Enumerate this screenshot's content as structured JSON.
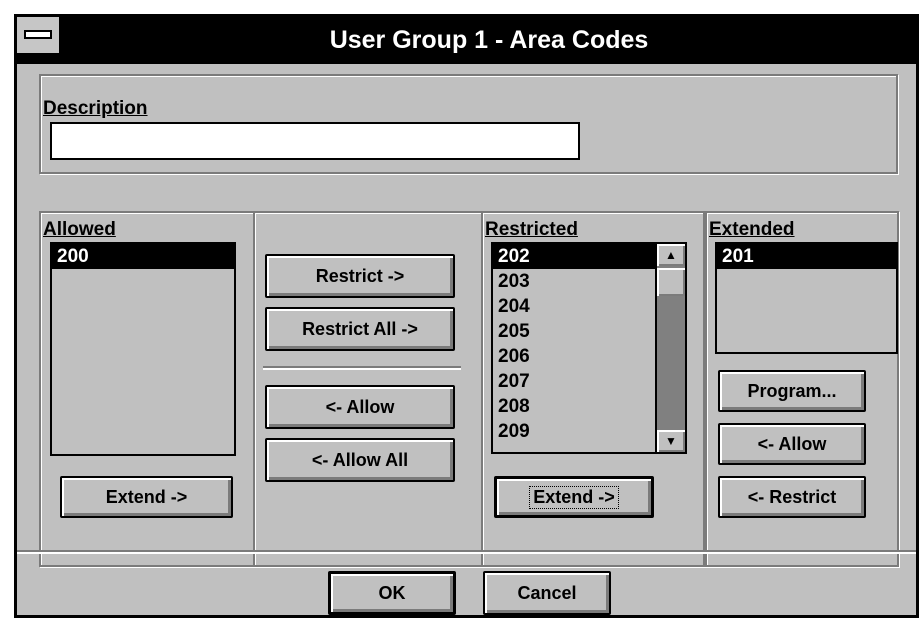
{
  "window": {
    "title": "User Group 1 - Area Codes"
  },
  "description": {
    "label": "Description",
    "value": ""
  },
  "allowed": {
    "label": "Allowed",
    "items": [
      "200"
    ],
    "extend_button": "Extend ->"
  },
  "middle": {
    "restrict_button": "Restrict ->",
    "restrict_all_button": "Restrict All ->",
    "allow_button": "<- Allow",
    "allow_all_button": "<- Allow All"
  },
  "restricted": {
    "label": "Restricted",
    "items": [
      "202",
      "203",
      "204",
      "205",
      "206",
      "207",
      "208",
      "209"
    ],
    "extend_button": "Extend ->"
  },
  "extended": {
    "label": "Extended",
    "items": [
      "201"
    ],
    "program_button": "Program...",
    "allow_button": "<- Allow",
    "restrict_button": "<- Restrict"
  },
  "footer": {
    "ok_button": "OK",
    "cancel_button": "Cancel"
  },
  "icons": {
    "system_menu": "system-menu-icon",
    "scroll_up": "up-arrow-icon",
    "scroll_down": "down-arrow-icon"
  }
}
